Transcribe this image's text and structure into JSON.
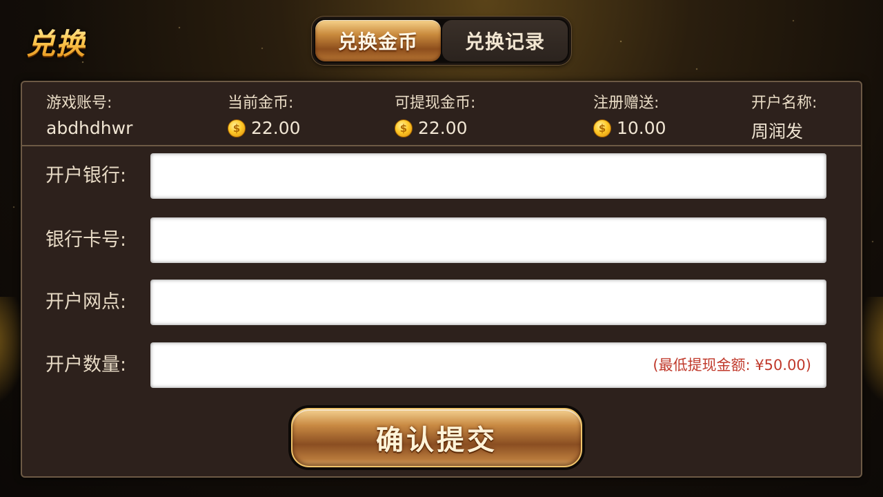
{
  "header": {
    "title": "兑换",
    "tabs": [
      {
        "label": "兑换金币",
        "active": true
      },
      {
        "label": "兑换记录",
        "active": false
      }
    ]
  },
  "account_info": {
    "account": {
      "label": "游戏账号:",
      "value": "abdhdhwr"
    },
    "current_coins": {
      "label": "当前金币:",
      "value": "22.00"
    },
    "withdrawable_coins": {
      "label": "可提现金币:",
      "value": "22.00"
    },
    "register_bonus": {
      "label": "注册赠送:",
      "value": "10.00"
    },
    "account_name": {
      "label": "开户名称:",
      "value": "周润发"
    }
  },
  "form": {
    "bank": {
      "label": "开户银行:",
      "value": "",
      "placeholder": ""
    },
    "card_number": {
      "label": "银行卡号:",
      "value": "",
      "placeholder": ""
    },
    "branch": {
      "label": "开户网点:",
      "value": "",
      "placeholder": ""
    },
    "amount": {
      "label": "开户数量:",
      "value": "",
      "placeholder": "",
      "hint": "(最低提现金额: ¥50.00)"
    }
  },
  "submit": {
    "label": "确认提交"
  },
  "colors": {
    "accent_gold": "#f0c46a",
    "panel_bg": "#2d211c",
    "panel_border": "#6d5a45",
    "hint_red": "#c0392b"
  },
  "icons": {
    "coin": "gold-coin-icon"
  }
}
